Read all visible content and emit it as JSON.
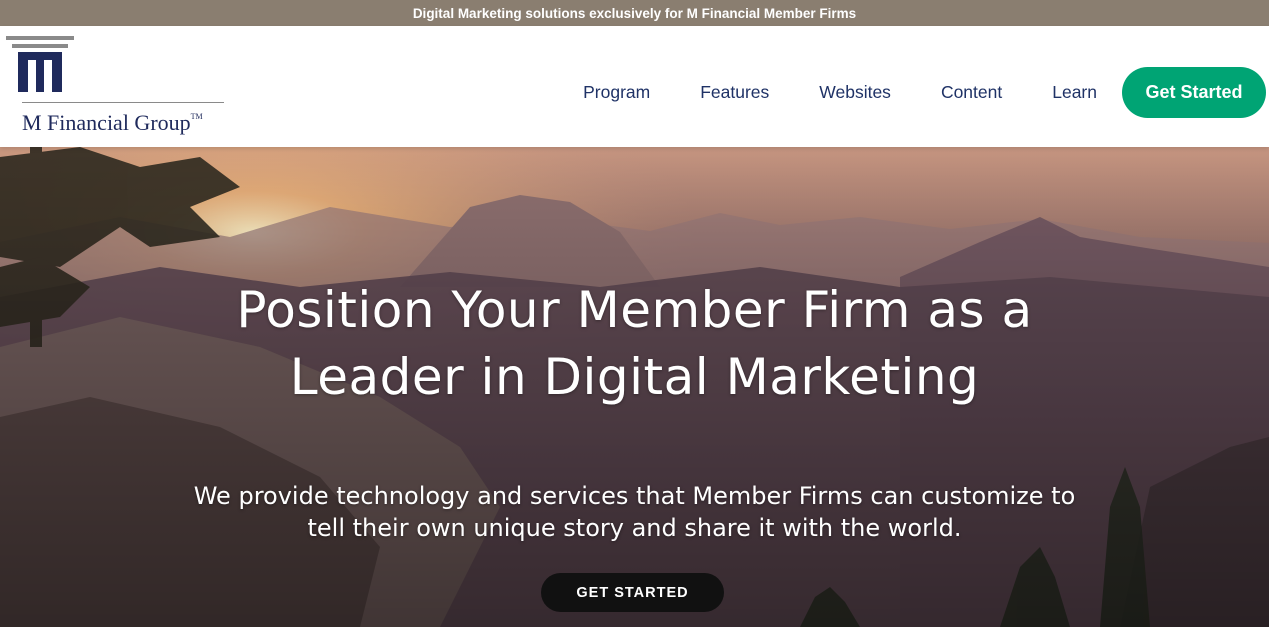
{
  "announcement": "Digital Marketing solutions exclusively for M Financial Member Firms",
  "brand": {
    "name": "M Financial Group",
    "trademark": "TM",
    "color": "#1f2a5c"
  },
  "nav": {
    "items": [
      "Program",
      "Features",
      "Websites",
      "Content",
      "Learn"
    ],
    "cta_label": "Get Started",
    "cta_color": "#00a474"
  },
  "hero": {
    "title_line1": "Position Your Member Firm as a",
    "title_line2": "Leader in Digital Marketing",
    "subtitle_line1": "We provide technology and services that Member Firms can customize to",
    "subtitle_line2": "tell their own unique story and share it with the world.",
    "button_label": "GET STARTED"
  }
}
